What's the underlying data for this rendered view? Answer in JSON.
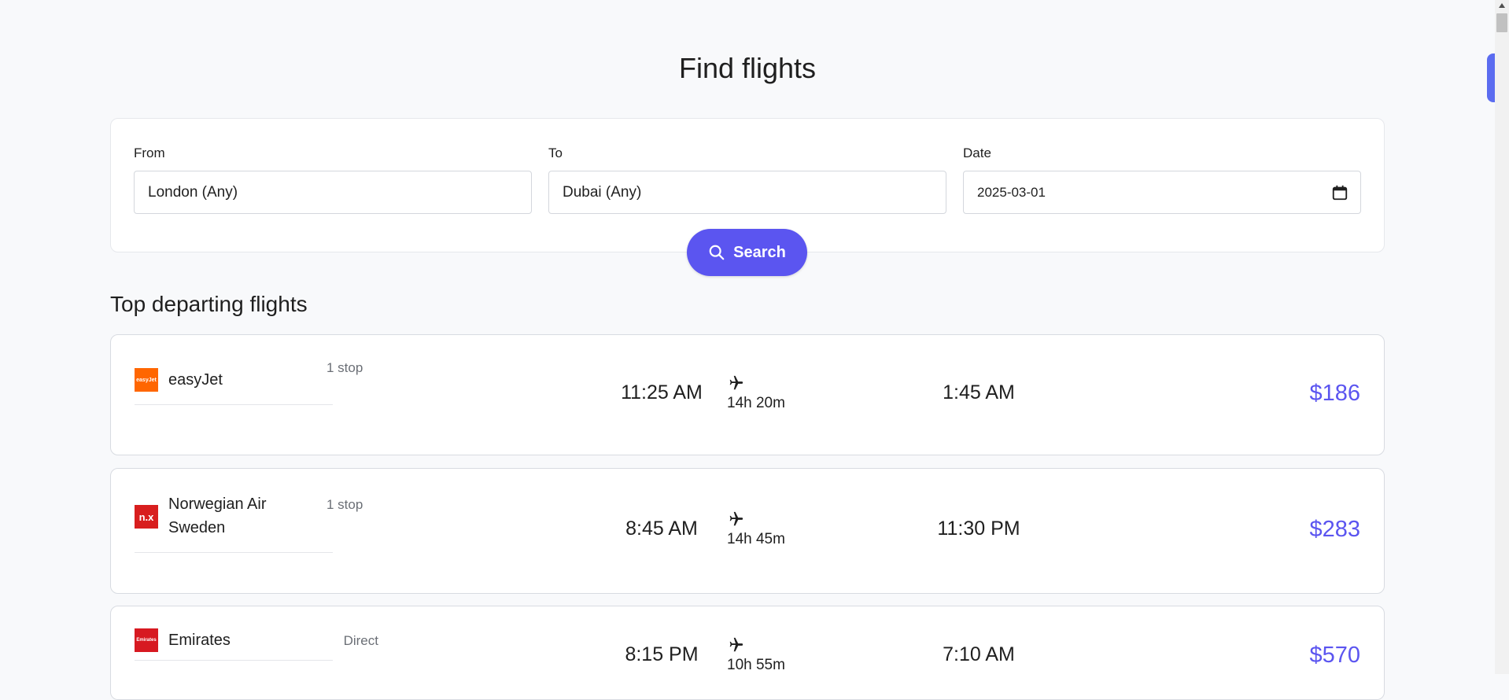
{
  "page": {
    "title": "Find flights"
  },
  "search": {
    "from_label": "From",
    "from_value": "London (Any)",
    "to_label": "To",
    "to_value": "Dubai (Any)",
    "date_label": "Date",
    "date_value": "2025-03-01",
    "button_label": "Search"
  },
  "results": {
    "title": "Top departing flights",
    "flights": [
      {
        "airline": "easyJet",
        "logo_text": "easyJet",
        "logo_color": "#ff6600",
        "stops": "1 stop",
        "depart": "11:25 AM",
        "duration": "14h 20m",
        "arrive": "1:45 AM",
        "price": "$186"
      },
      {
        "airline": "Norwegian Air Sweden",
        "logo_text": "n.x",
        "logo_color": "#d81e1e",
        "stops": "1 stop",
        "depart": "8:45 AM",
        "duration": "14h 45m",
        "arrive": "11:30 PM",
        "price": "$283"
      },
      {
        "airline": "Emirates",
        "logo_text": "Emirates",
        "logo_color": "#d71921",
        "stops": "Direct",
        "depart": "8:15 PM",
        "duration": "10h 55m",
        "arrive": "7:10 AM",
        "price": "$570"
      }
    ]
  },
  "colors": {
    "accent": "#5b55f0",
    "background": "#f8f9fb",
    "card": "#ffffff"
  },
  "icons": {
    "search": "magnifier-icon",
    "calendar": "calendar-icon",
    "plane": "airplane-icon"
  }
}
